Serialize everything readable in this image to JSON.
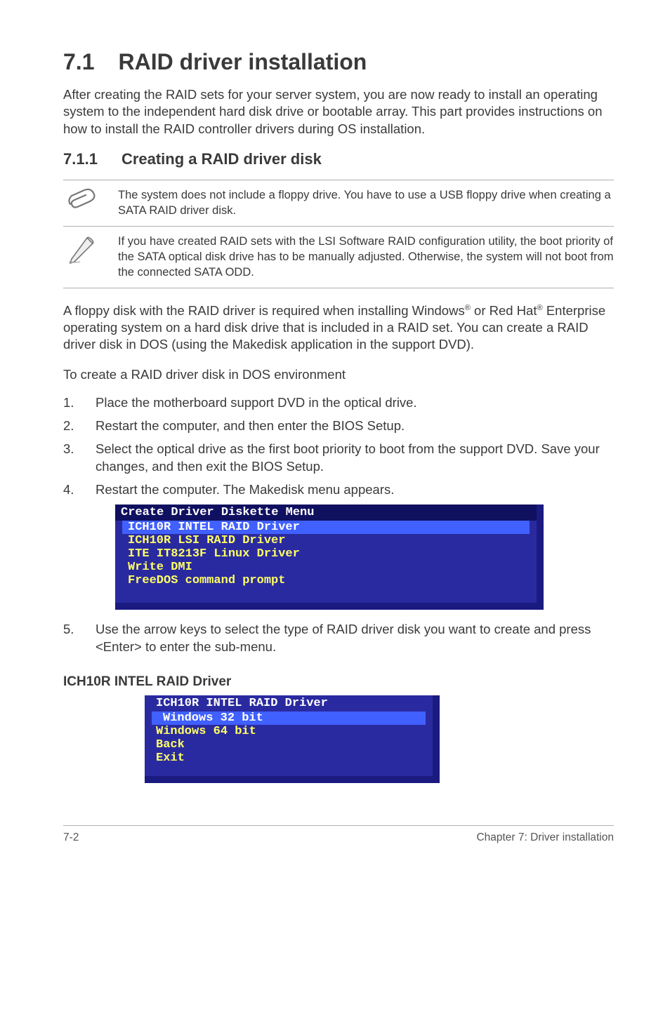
{
  "section": {
    "number": "7.1",
    "title": "RAID driver installation",
    "intro": "After creating the RAID sets for your server system, you are now ready to install an operating system to the independent hard disk drive or bootable array. This part provides instructions on how to install the RAID controller drivers during OS installation."
  },
  "subsection": {
    "number": "7.1.1",
    "title": "Creating a RAID driver disk"
  },
  "notes": [
    {
      "icon": "paperclip-icon",
      "text": "The system does not include a floppy drive. You have to use a USB floppy drive when creating a SATA RAID driver disk."
    },
    {
      "icon": "pencil-icon",
      "text": "If you have created RAID sets with the LSI Software RAID configuration utility, the boot priority of the SATA optical disk drive has to be manually adjusted. Otherwise, the system will not boot from the connected SATA ODD."
    }
  ],
  "paragraphs": {
    "p1a": "A floppy disk with the RAID driver is required when installing Windows",
    "p1b": " or Red Hat",
    "p1c": " Enterprise operating system on a hard disk drive that is included in a RAID set. You can create a RAID driver disk in DOS (using the Makedisk application in the support DVD).",
    "p2": "To create a RAID driver disk in DOS environment"
  },
  "reg": "®",
  "steps": [
    {
      "n": "1.",
      "t": "Place the motherboard support DVD in the optical drive."
    },
    {
      "n": "2.",
      "t": "Restart the computer, and then enter the BIOS Setup."
    },
    {
      "n": "3.",
      "t": "Select the optical drive as the first boot priority to boot from the support DVD. Save your changes, and then exit the BIOS Setup."
    },
    {
      "n": "4.",
      "t": "Restart the computer. The Makedisk menu appears."
    }
  ],
  "terminal1": {
    "header": "Create Driver Diskette Menu",
    "selected": "ICH10R INTEL RAID Driver",
    "items": [
      "ICH10R LSI RAID Driver",
      "ITE IT8213F Linux Driver",
      "Write DMI",
      "FreeDOS command prompt"
    ]
  },
  "step5": {
    "n": "5.",
    "t": "Use the arrow keys to select the type of RAID driver disk you want to create and press <Enter> to enter the sub-menu."
  },
  "subhead": "ICH10R INTEL RAID Driver",
  "terminal2": {
    "header": "ICH10R INTEL RAID Driver",
    "selected": "Windows 32 bit",
    "items": [
      "Windows 64 bit",
      "Back",
      "Exit"
    ]
  },
  "footer": {
    "left": "7-2",
    "right": "Chapter 7: Driver installation"
  }
}
